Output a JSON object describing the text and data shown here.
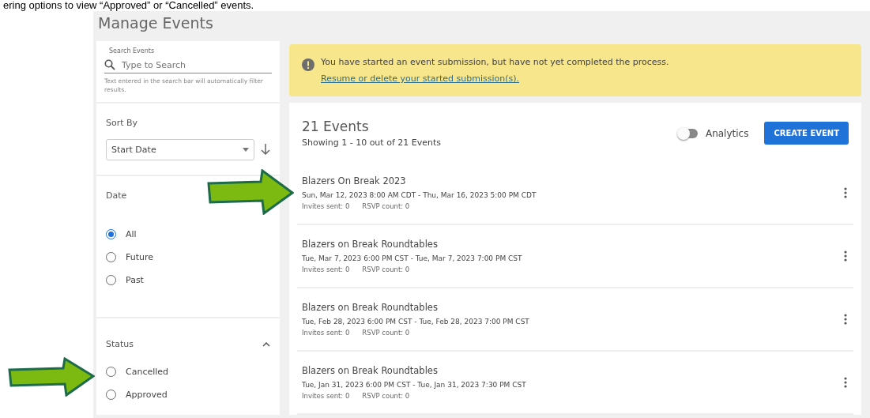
{
  "caption": "ering options to view “Approved” or “Cancelled” events.",
  "page": {
    "title": "Manage Events"
  },
  "search": {
    "label": "Search Events",
    "placeholder": "Type to Search",
    "help": "Text entered in the search bar will automatically filter results."
  },
  "sort": {
    "label": "Sort By",
    "value": "Start Date"
  },
  "date_filter": {
    "label": "Date",
    "options": [
      {
        "label": "All",
        "selected": true
      },
      {
        "label": "Future",
        "selected": false
      },
      {
        "label": "Past",
        "selected": false
      }
    ]
  },
  "status_filter": {
    "label": "Status",
    "expanded": true,
    "options": [
      {
        "label": "Cancelled",
        "selected": false
      },
      {
        "label": "Approved",
        "selected": false
      }
    ]
  },
  "alert": {
    "text": "You have started an event submission, but have not yet completed the process.",
    "link": "Resume or delete your started submission(s)."
  },
  "events_header": {
    "count": "21 Events",
    "showing": "Showing 1 - 10 out of 21 Events",
    "analytics": {
      "label": "Analytics",
      "on": false
    },
    "create_button": "CREATE EVENT"
  },
  "events": [
    {
      "title": "Blazers On Break 2023",
      "dates": "Sun, Mar 12, 2023 8:00 AM CDT - Thu, Mar 16, 2023 5:00 PM CDT",
      "invites": "Invites sent: 0",
      "rsvp": "RSVP count: 0"
    },
    {
      "title": "Blazers on Break Roundtables",
      "dates": "Tue, Mar 7, 2023 6:00 PM CST - Tue, Mar 7, 2023 7:00 PM CST",
      "invites": "Invites sent: 0",
      "rsvp": "RSVP count: 0"
    },
    {
      "title": "Blazers on Break Roundtables",
      "dates": "Tue, Feb 28, 2023 6:00 PM CST - Tue, Feb 28, 2023 7:00 PM CST",
      "invites": "Invites sent: 0",
      "rsvp": "RSVP count: 0"
    },
    {
      "title": "Blazers on Break Roundtables",
      "dates": "Tue, Jan 31, 2023 6:00 PM CST - Tue, Jan 31, 2023 7:30 PM CST",
      "invites": "Invites sent: 0",
      "rsvp": "RSVP count: 0"
    }
  ]
}
